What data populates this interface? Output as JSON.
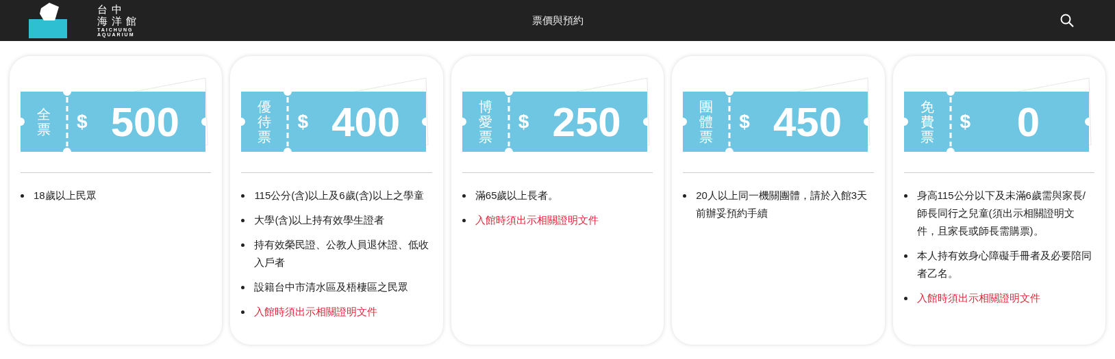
{
  "header": {
    "logo": {
      "name_line_1": "台 中",
      "name_line_2": "海 洋 館",
      "english_line_1": "TAICHUNG",
      "english_line_2": "AQUARIUM"
    },
    "title": "票價與預約"
  },
  "tickets": [
    {
      "label": "全票",
      "currency": "$",
      "price": "500",
      "notes": [
        {
          "kind": "text",
          "text": "18歲以上民眾"
        }
      ]
    },
    {
      "label": "優待票",
      "currency": "$",
      "price": "400",
      "notes": [
        {
          "kind": "text",
          "text": "115公分(含)以上及6歲(含)以上之學童"
        },
        {
          "kind": "text",
          "text": "大學(含)以上持有效學生證者"
        },
        {
          "kind": "text",
          "text": "持有效榮民證、公教人員退休證、低收入戶者"
        },
        {
          "kind": "text",
          "text": "設籍台中市清水區及梧棲區之民眾"
        },
        {
          "kind": "notice",
          "text": "入館時須出示相關證明文件"
        }
      ]
    },
    {
      "label": "博愛票",
      "currency": "$",
      "price": "250",
      "notes": [
        {
          "kind": "text",
          "text": "滿65歲以上長者。"
        },
        {
          "kind": "notice",
          "text": "入館時須出示相關證明文件"
        }
      ]
    },
    {
      "label": "團體票",
      "currency": "$",
      "price": "450",
      "notes": [
        {
          "kind": "text",
          "text": "20人以上同一機關團體，請於入館3天前辦妥預約手續"
        }
      ]
    },
    {
      "label": "免費票",
      "currency": "$",
      "price": "0",
      "notes": [
        {
          "kind": "text",
          "text": "身高115公分以下及未滿6歲需與家長/師長同行之兒童(須出示相關證明文件，且家長或師長需購票)。"
        },
        {
          "kind": "text",
          "text": "本人持有效身心障礙手冊者及必要陪同者乙名。"
        },
        {
          "kind": "notice",
          "text": "入館時須出示相關證明文件"
        }
      ]
    }
  ]
}
